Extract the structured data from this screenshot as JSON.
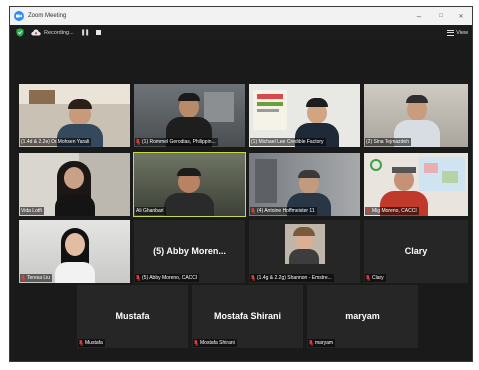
{
  "window": {
    "title": "Zoom Meeting",
    "minimize": "–",
    "maximize": "□",
    "close": "✕"
  },
  "toolbar": {
    "recording_label": "Recording...",
    "pause_glyph": "❚❚",
    "view_label": "View"
  },
  "colors": {
    "zoom_blue": "#2d8cff",
    "active_speaker": "#c6d84b",
    "muted_red": "#e0413b",
    "tile_bg": "#262626",
    "window_bg": "#1a1a1a"
  },
  "participants": [
    {
      "name": "(1.4d & 2.2e) Dr.Mohsen Yarali",
      "video": true,
      "muted": false
    },
    {
      "name": "(1) Rommel Gerodias, Philippin...",
      "video": true,
      "muted": true
    },
    {
      "name": "(1) Michael Lee Credible Factory",
      "video": true,
      "muted": false
    },
    {
      "name": "(2) Sina Tejmazdeh",
      "video": true,
      "muted": false
    },
    {
      "name": "Vida Lotfi",
      "video": true,
      "muted": false
    },
    {
      "name": "Ali Ghanbari",
      "video": true,
      "muted": false,
      "active": true
    },
    {
      "name": "(4) Antoine Hoffmeister 11",
      "video": true,
      "muted": true
    },
    {
      "name": "Mig Moreno, CACCI",
      "video": true,
      "muted": true
    },
    {
      "name": "Teresa Liu",
      "video": true,
      "muted": true
    },
    {
      "name": "(5) Abby Moreno, CACCI",
      "video": false,
      "muted": true,
      "display": "(5) Abby Moren..."
    },
    {
      "name": "(1.4g & 2.2g) Shannon - Emstre...",
      "video": true,
      "muted": true
    },
    {
      "name": "Clary",
      "video": false,
      "muted": true,
      "display": "Clary"
    },
    {
      "name": "Mustafa",
      "video": false,
      "muted": true,
      "display": "Mustafa"
    },
    {
      "name": "Mostafa Shirani",
      "video": false,
      "muted": true,
      "display": "Mostafa Shirani"
    },
    {
      "name": "maryam",
      "video": false,
      "muted": true,
      "display": "maryam"
    }
  ]
}
